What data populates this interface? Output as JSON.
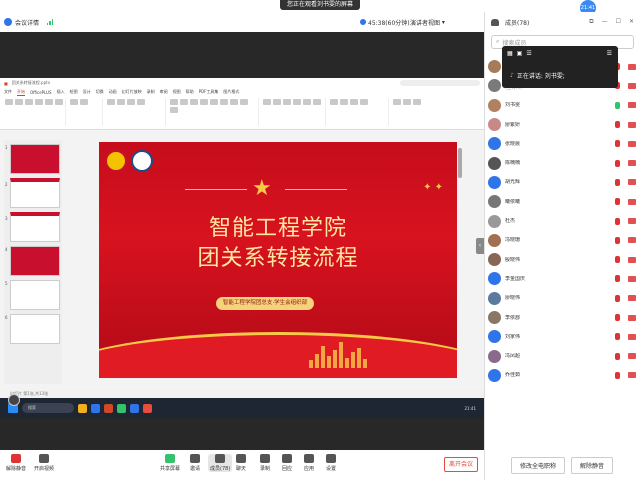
{
  "banner": {
    "text": "您正在观看刘书雯的屏幕"
  },
  "topbar": {
    "title": "会议详情",
    "timer": "45:38(60分钟)",
    "view": "演讲者视图"
  },
  "time_badge": "21:41",
  "panel": {
    "title": "成员(78)",
    "search_placeholder": "搜索成员",
    "speaking_label": "正在讲话: 刘书雯;",
    "participants": [
      {
        "name": "陈正源",
        "role": "",
        "color": "#a57b5a",
        "mic": "off"
      },
      {
        "name": "MY ANSWER",
        "role": "(主持人)",
        "color": "#7a7a7a",
        "mic": "off"
      },
      {
        "name": "刘书雯",
        "role": "",
        "color": "#b08060",
        "mic": "on"
      },
      {
        "name": "廖紫妍",
        "role": "",
        "color": "#c88888",
        "mic": "off"
      },
      {
        "name": "张晓晨",
        "role": "",
        "color": "#2f74e8",
        "mic": "off"
      },
      {
        "name": "陈楠楠",
        "role": "",
        "color": "#555555",
        "mic": "off"
      },
      {
        "name": "胡光辉",
        "role": "",
        "color": "#2f74e8",
        "mic": "off"
      },
      {
        "name": "曦依曦",
        "role": "",
        "color": "#777777",
        "mic": "off"
      },
      {
        "name": "杜杰",
        "role": "",
        "color": "#999999",
        "mic": "off"
      },
      {
        "name": "冯晓珊",
        "role": "",
        "color": "#a07050",
        "mic": "off"
      },
      {
        "name": "殷晓伟",
        "role": "",
        "color": "#886655",
        "mic": "off"
      },
      {
        "name": "李金国庆",
        "role": "",
        "color": "#2f74e8",
        "mic": "off"
      },
      {
        "name": "廖晓伟",
        "role": "",
        "color": "#5a7aa0",
        "mic": "off"
      },
      {
        "name": "李依郡",
        "role": "",
        "color": "#887766",
        "mic": "off"
      },
      {
        "name": "刘家伟",
        "role": "",
        "color": "#2f74e8",
        "mic": "off"
      },
      {
        "name": "冯凤超",
        "role": "",
        "color": "#8a6a8a",
        "mic": "off"
      },
      {
        "name": "乔佳茹",
        "role": "",
        "color": "#2f74e8",
        "mic": "off"
      }
    ],
    "footer": {
      "mute_all": "修改全电职称",
      "unmute_all": "解除静音"
    }
  },
  "bottom": {
    "buttons": [
      "解除静音",
      "开启视频",
      "共享屏幕",
      "邀请",
      "成员(78)",
      "聊天",
      "录制",
      "回应",
      "应用",
      "设置"
    ],
    "leave": "离开会议"
  },
  "ppt": {
    "title": "团关系转接流程.pptx",
    "tabs": [
      "文件",
      "开始",
      "OfficePLUS",
      "插入",
      "绘图",
      "设计",
      "切换",
      "动画",
      "幻灯片放映",
      "录制",
      "审阅",
      "视图",
      "帮助",
      "PDF工具集",
      "图片格式"
    ],
    "notes": "单击此处添加备注",
    "status": "幻灯片 第1张,共13张",
    "search": "搜索",
    "time": "21:41"
  },
  "slide": {
    "line1": "智能工程学院",
    "line2": "团关系转接流程",
    "badge": "智能工程学院团总支·学生会组织部"
  }
}
